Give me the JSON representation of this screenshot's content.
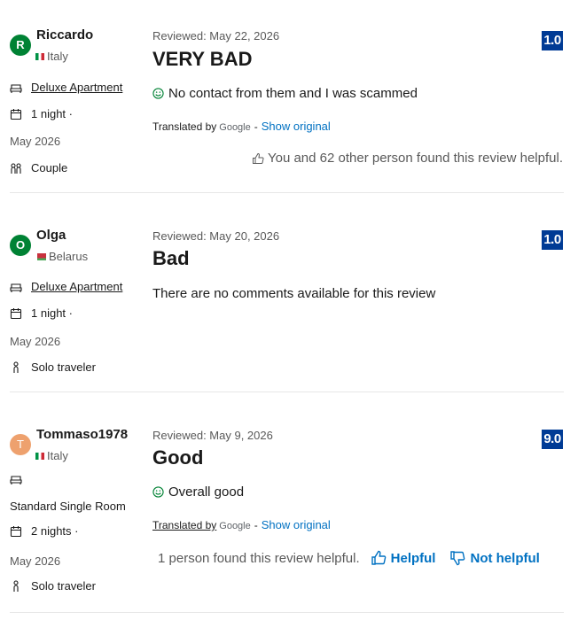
{
  "colors": {
    "score_bg": "#003b95",
    "link": "#0071c2",
    "avatar_green": "#008234",
    "avatar_orange": "#eea16e"
  },
  "reviews": [
    {
      "initial": "R",
      "name": "Riccardo",
      "country": "Italy",
      "flag": "italy-flag",
      "room": "Deluxe Apartment",
      "nights": "1 night ·",
      "date": "May 2026",
      "traveler_type": "Couple",
      "traveler_icon": "group-icon",
      "reviewed": "Reviewed: May 22, 2026",
      "title": "VERY BAD",
      "body": "No contact from them and I was scammed",
      "translated_by": "Translated by",
      "google": "Google",
      "dash": "-",
      "show_original": "Show original",
      "score": "1.0",
      "helpful_text": "You and 62 other person found this review helpful."
    },
    {
      "initial": "O",
      "name": "Olga",
      "country": "Belarus",
      "flag": "belarus-flag",
      "room": "Deluxe Apartment",
      "nights": "1 night ·",
      "date": "May 2026",
      "traveler_type": "Solo traveler",
      "traveler_icon": "person-icon",
      "reviewed": "Reviewed: May 20, 2026",
      "title": "Bad",
      "body": "There are no comments available for this review",
      "score": "1.0"
    },
    {
      "initial": "T",
      "name": "Tommaso1978",
      "country": "Italy",
      "flag": "italy-flag",
      "room": "Standard Single Room",
      "nights": "2 nights ·",
      "date": "May 2026",
      "traveler_type": "Solo traveler",
      "traveler_icon": "person-icon",
      "reviewed": "Reviewed: May 9, 2026",
      "title": "Good",
      "body": "Overall good",
      "translated_by": "Translated by",
      "google": "Google",
      "dash": "-",
      "show_original": "Show original",
      "score": "9.0",
      "helpful_count": "1 person found this review helpful.",
      "helpful_label": "Helpful",
      "not_helpful_label": "Not helpful"
    }
  ]
}
